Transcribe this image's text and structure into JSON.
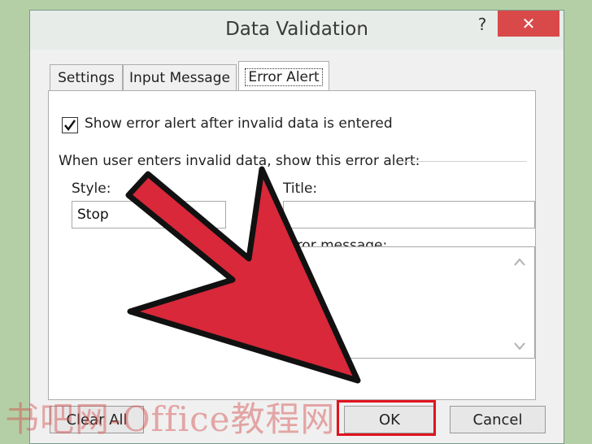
{
  "dialog": {
    "title": "Data Validation",
    "help_label": "?",
    "close_label": "✕"
  },
  "tabs": [
    {
      "label": "Settings"
    },
    {
      "label": "Input Message"
    },
    {
      "label": "Error Alert",
      "active": true
    }
  ],
  "error_alert": {
    "show_alert_label": "Show error alert after invalid data is entered",
    "show_alert_checked": true,
    "group_label": "When user enters invalid data, show this error alert:",
    "style_label": "Style:",
    "style_value": "Stop",
    "title_label": "Title:",
    "title_value": "",
    "message_label": "rror message:",
    "message_value": ""
  },
  "buttons": {
    "clear_all": "Clear All",
    "ok": "OK",
    "cancel": "Cancel"
  },
  "overlay": {
    "watermark": "书吧网-Office教程网",
    "arrow_color": "#d8283a",
    "highlight_color": "#e0141e"
  }
}
